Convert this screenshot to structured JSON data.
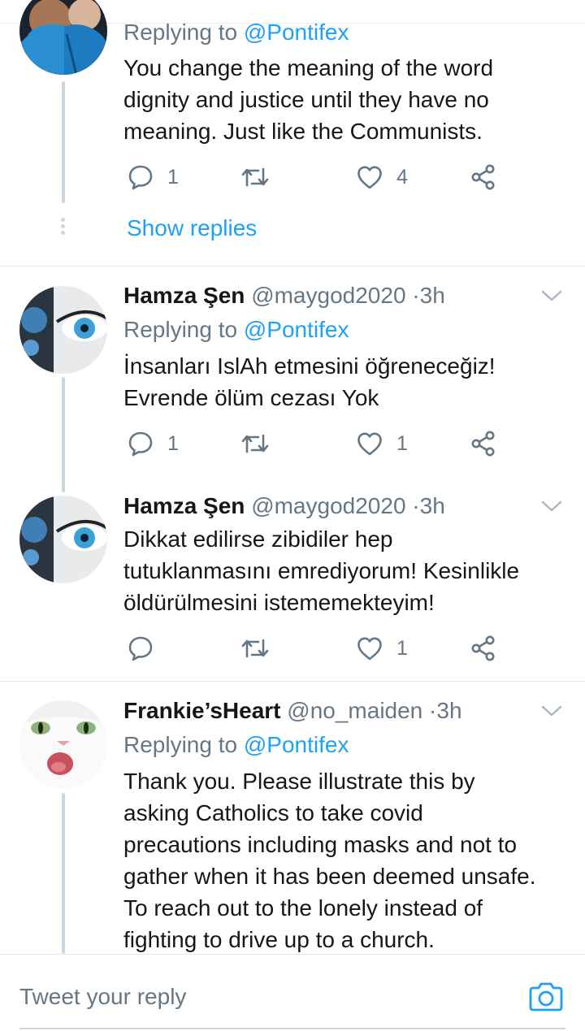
{
  "tweets": [
    {
      "reply_prefix": "Replying to ",
      "reply_mention": "@Pontifex",
      "text_lines": [
        "You change the meaning of the word",
        "dignity and justice until they have no",
        "meaning. Just like the Communists."
      ],
      "replies": "1",
      "likes": "4",
      "show_replies": "Show replies"
    },
    {
      "name": "Hamza Şen",
      "handle": "@maygod2020",
      "sep": "·",
      "time": "3h",
      "reply_prefix": "Replying to ",
      "reply_mention": "@Pontifex",
      "text_lines": [
        "İnsanları IslAh etmesini öğreneceğiz!",
        "Evrende ölüm cezası Yok"
      ],
      "replies": "1",
      "likes": "1"
    },
    {
      "name": "Hamza Şen",
      "handle": "@maygod2020",
      "sep": "·",
      "time": "3h",
      "text_lines": [
        "Dikkat edilirse zibidiler hep",
        "tutuklanmasını emrediyorum! Kesinlikle",
        "öldürülmesini istememekteyim!"
      ],
      "likes": "1"
    },
    {
      "name": "Frankie’sHeart",
      "handle": "@no_maiden",
      "sep": "·",
      "time": "3h",
      "reply_prefix": "Replying to ",
      "reply_mention": "@Pontifex",
      "text_lines": [
        "Thank you. Please illustrate  this by",
        "asking Catholics to take covid",
        "precautions including masks and not to",
        "gather when it has been deemed unsafe.",
        "To reach out to the lonely instead of",
        "fighting to drive up to a church."
      ]
    }
  ],
  "composer": {
    "placeholder": "Tweet your reply"
  },
  "colors": {
    "accent": "#1da1f2",
    "secondary_text": "#657786",
    "divider": "#e1e8ed"
  },
  "icons": [
    "reply-icon",
    "retweet-icon",
    "like-icon",
    "share-icon",
    "chevron-down-icon",
    "camera-icon"
  ]
}
